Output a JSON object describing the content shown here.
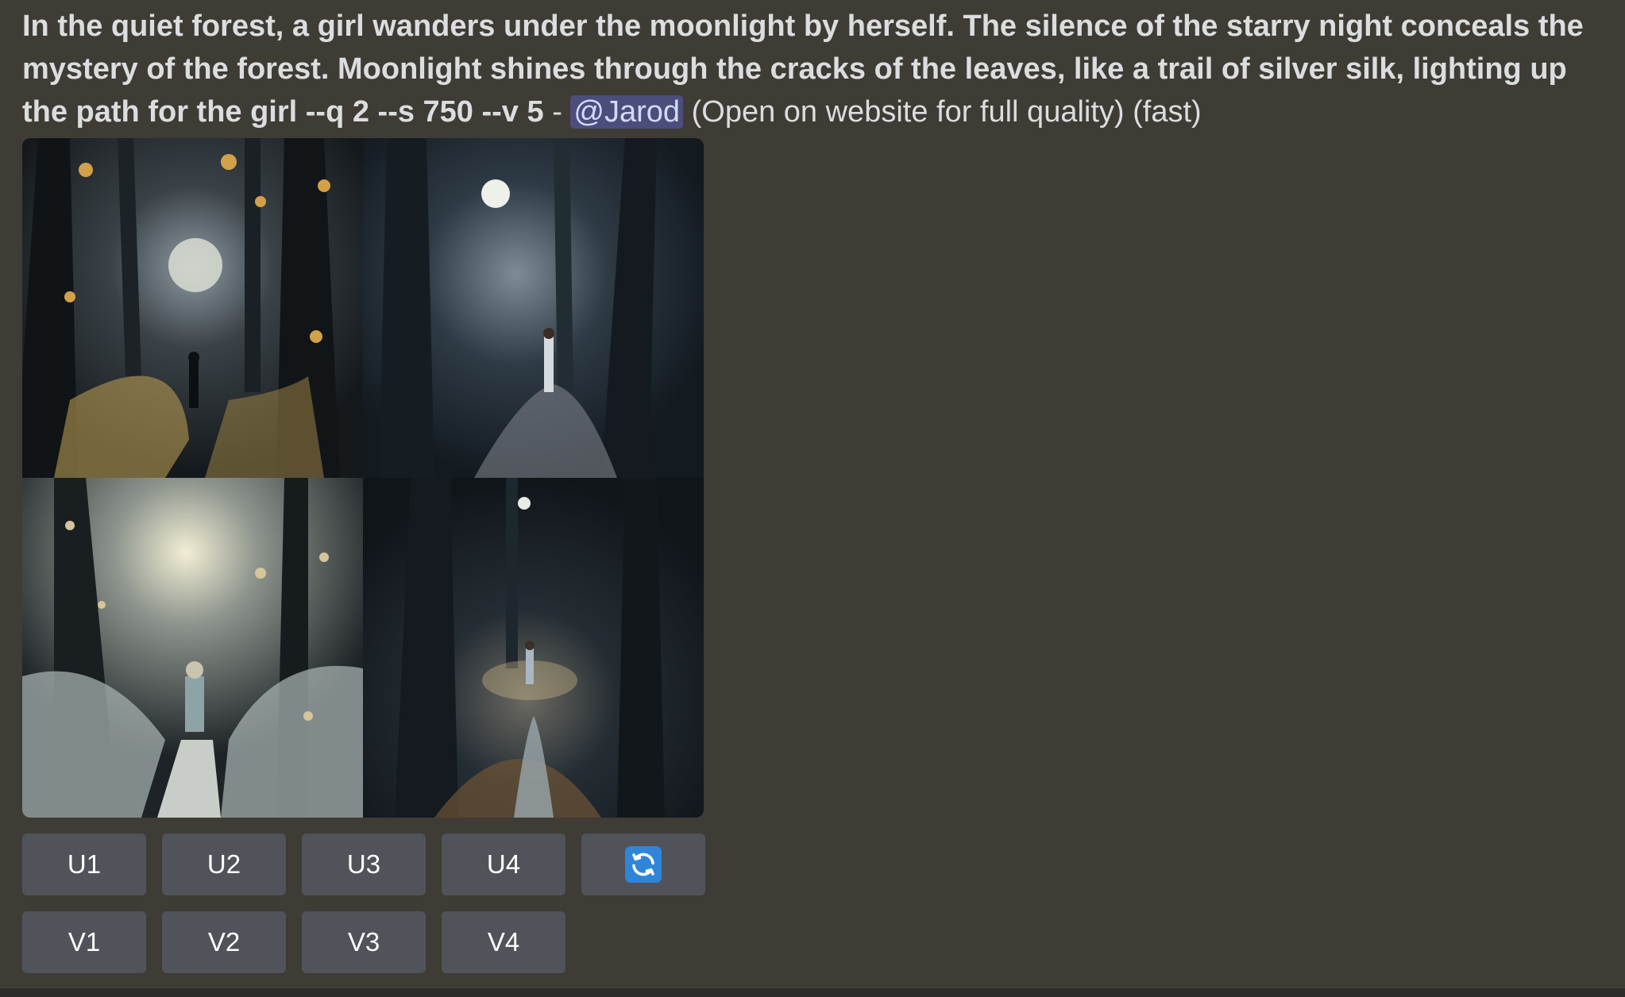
{
  "message": {
    "prompt": "In the quiet forest, a girl wanders under the moonlight by herself. The silence of the starry night conceals the mystery of the forest. Moonlight shines through the cracks of the leaves, like a trail of silver silk, lighting up the path for the girl --q 2 --s 750 --v 5",
    "separator": " - ",
    "mention": "@Jarod",
    "suffix": " (Open on website for full quality) (fast)"
  },
  "image_grid": {
    "images": [
      "forest-image-1",
      "forest-image-2",
      "forest-image-3",
      "forest-image-4"
    ]
  },
  "buttons": {
    "upscale": [
      "U1",
      "U2",
      "U3",
      "U4"
    ],
    "variation": [
      "V1",
      "V2",
      "V3",
      "V4"
    ],
    "reroll_icon": "refresh-icon",
    "reroll_color": "#2f86d8"
  }
}
